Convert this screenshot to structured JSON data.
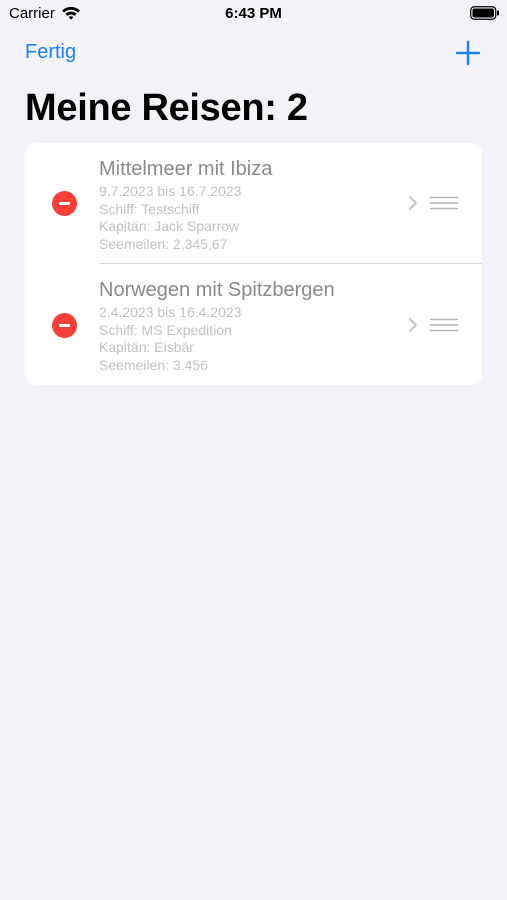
{
  "status_bar": {
    "carrier": "Carrier",
    "time": "6:43 PM",
    "icons": [
      "wifi-icon",
      "battery-icon"
    ]
  },
  "nav": {
    "done_label": "Fertig",
    "add_icon": "plus-icon"
  },
  "title": "Meine Reisen: 2",
  "colors": {
    "accent": "#1a82f5",
    "delete": "#f5403a",
    "background": "#f2f2f7",
    "card": "#ffffff"
  },
  "trips": [
    {
      "name": "Mittelmeer mit Ibiza",
      "dates": "9.7.2023 bis 16.7.2023",
      "ship": "Schiff: Testschiff",
      "captain": "Kapitän: Jack Sparrow",
      "miles": "Seemeilen: 2.345,67"
    },
    {
      "name": "Norwegen mit Spitzbergen",
      "dates": "2.4.2023 bis 16.4.2023",
      "ship": "Schiff: MS Expedition",
      "captain": "Kapitän: Eisbär",
      "miles": "Seemeilen: 3.456"
    }
  ]
}
